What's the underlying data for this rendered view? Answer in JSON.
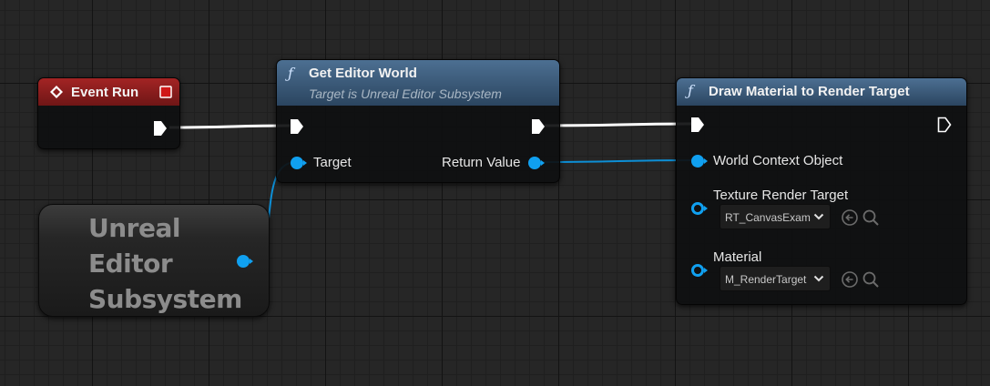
{
  "graph": {
    "event_node": {
      "title": "Event Run",
      "icon": "event-diamond-icon",
      "accent_color": "#8c1a1a"
    },
    "get_world_node": {
      "title": "Get Editor World",
      "subtitle": "Target is Unreal Editor Subsystem",
      "icon": "function-icon",
      "target_label": "Target",
      "return_label": "Return Value",
      "header_color": "#3d5f80"
    },
    "subsystem_node": {
      "line1": "Unreal",
      "line2": "Editor",
      "line3": "Subsystem"
    },
    "draw_node": {
      "title": "Draw Material to Render Target",
      "icon": "function-icon",
      "world_context_label": "World Context Object",
      "texture_label": "Texture Render Target",
      "texture_value": "RT_CanvasExample",
      "material_label": "Material",
      "material_value": "M_RenderTarget",
      "header_color": "#3d5f80"
    },
    "colors": {
      "object_pin": "#10a0f0",
      "exec_pin": "#ffffff",
      "background": "#262626"
    }
  }
}
